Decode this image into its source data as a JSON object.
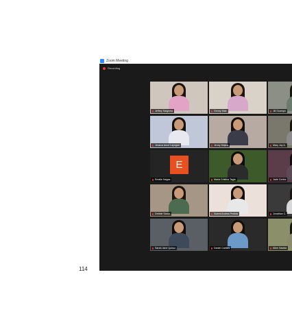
{
  "window": {
    "title": "Zoom Meeting",
    "recording_label": "Recording"
  },
  "page_number": "114",
  "colors": {
    "accent": "#2d8cff",
    "recording": "#e53935",
    "avatar_bg": "#e8501f",
    "active_border": "#e8f08a"
  },
  "tiles": [
    {
      "name": "Jeffrey Sargento",
      "kind": "video",
      "bg": "#cfc6bd",
      "shirt": "#e3a3c6",
      "hair": "#1b1410"
    },
    {
      "name": "Genny Mae",
      "kind": "video",
      "bg": "#d9d2c8",
      "shirt": "#d7a8c9",
      "hair": "#1d1410",
      "active": true
    },
    {
      "name": "Jill Ocampo",
      "kind": "video",
      "bg": "#8c8f86",
      "shirt": "#6a7b6e",
      "hair": "#1a1411"
    },
    {
      "name": "Jessica Anne Layugan",
      "kind": "video",
      "bg": "#c0c7d9",
      "shirt": "#e8e8f0",
      "hair": "#16100c"
    },
    {
      "name": "Jenny Mojica",
      "kind": "video",
      "bg": "#b7aaa3",
      "shirt": "#3b3c4a",
      "hair": "#140e0b"
    },
    {
      "name": "Mary Joy A.",
      "kind": "video",
      "bg": "#7a776d",
      "shirt": "#8a8a8a",
      "hair": "#1a1410"
    },
    {
      "name": "Emalie Nagas",
      "kind": "avatar",
      "initial": "E",
      "bg": "#242424"
    },
    {
      "name": "Maria Cristina Tagle",
      "kind": "video",
      "bg": "#3c5a2a",
      "shirt": "#2b2b2b",
      "hair": "#0e0a08"
    },
    {
      "name": "Jade Cortez",
      "kind": "video",
      "bg": "#5b3d4a",
      "shirt": "#5b4a55",
      "hair": "#140e0b"
    },
    {
      "name": "Debbie Sarun",
      "kind": "video",
      "bg": "#a59686",
      "shirt": "#4c6b4f",
      "hair": "#1b1410"
    },
    {
      "name": "Noemi Andrea Pedida",
      "kind": "video",
      "bg": "#ebe1da",
      "shirt": "#e8e8e8",
      "hair": "#120c0a"
    },
    {
      "name": "Jonathan C.",
      "kind": "video",
      "bg": "#3a3a3a",
      "shirt": "#d8d8d8",
      "hair": "#1a1410"
    },
    {
      "name": "Sarah Jane Quiroz",
      "kind": "video",
      "bg": "#5a5f66",
      "shirt": "#3e4a5a",
      "hair": "#120c0a"
    },
    {
      "name": "Daniel Cabiles",
      "kind": "video",
      "bg": "#2a2a2a",
      "shirt": "#6b9ac8",
      "hair": "#140e0b"
    },
    {
      "name": "Allen Navida",
      "kind": "video",
      "bg": "#8b8f6a",
      "shirt": "#8a8a6a",
      "hair": "#1a1410"
    }
  ]
}
